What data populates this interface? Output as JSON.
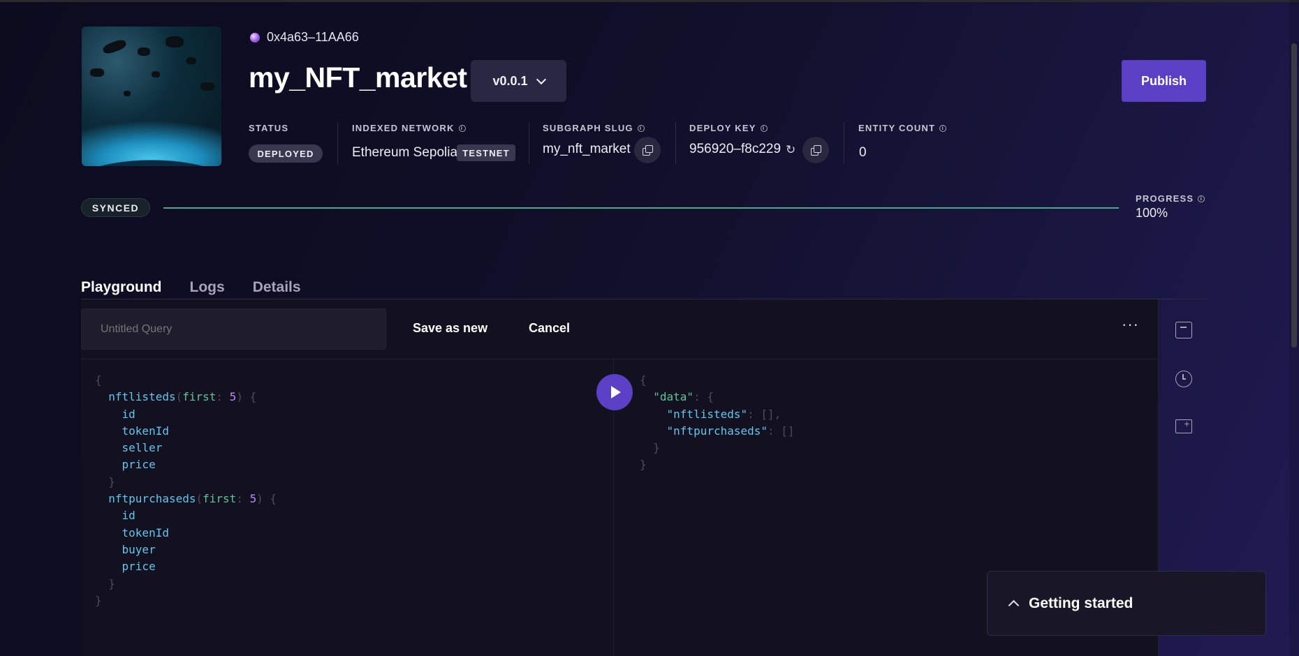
{
  "header": {
    "address": "0x4a63–11AA66",
    "title": "my_NFT_market",
    "version": "v0.0.1",
    "publish_label": "Publish"
  },
  "meta": {
    "status_label": "STATUS",
    "status_value": "DEPLOYED",
    "network_label": "INDEXED NETWORK",
    "network_value": "Ethereum Sepolia",
    "network_badge": "TESTNET",
    "slug_label": "SUBGRAPH SLUG",
    "slug_value": "my_nft_market",
    "deploy_key_label": "DEPLOY KEY",
    "deploy_key_value": "956920–f8c229",
    "entity_count_label": "ENTITY COUNT",
    "entity_count_value": "0"
  },
  "sync": {
    "badge": "SYNCED",
    "progress_label": "PROGRESS",
    "progress_value": "100%",
    "progress_fraction": 1.0
  },
  "tabs": [
    {
      "label": "Playground",
      "active": true
    },
    {
      "label": "Logs",
      "active": false
    },
    {
      "label": "Details",
      "active": false
    }
  ],
  "playground": {
    "query_placeholder": "Untitled Query",
    "save_label": "Save as new",
    "cancel_label": "Cancel"
  },
  "getting_started": {
    "label": "Getting started"
  },
  "colors": {
    "accent": "#5b3fc4",
    "progress": "#4aa98a",
    "background": "#110f29"
  },
  "icons": [
    "gem-icon",
    "chevron-down-icon",
    "info-icon",
    "copy-icon",
    "refresh-icon",
    "play-icon",
    "archive-icon",
    "history-icon",
    "folder-add-icon",
    "chevron-up-icon",
    "more-icon"
  ]
}
